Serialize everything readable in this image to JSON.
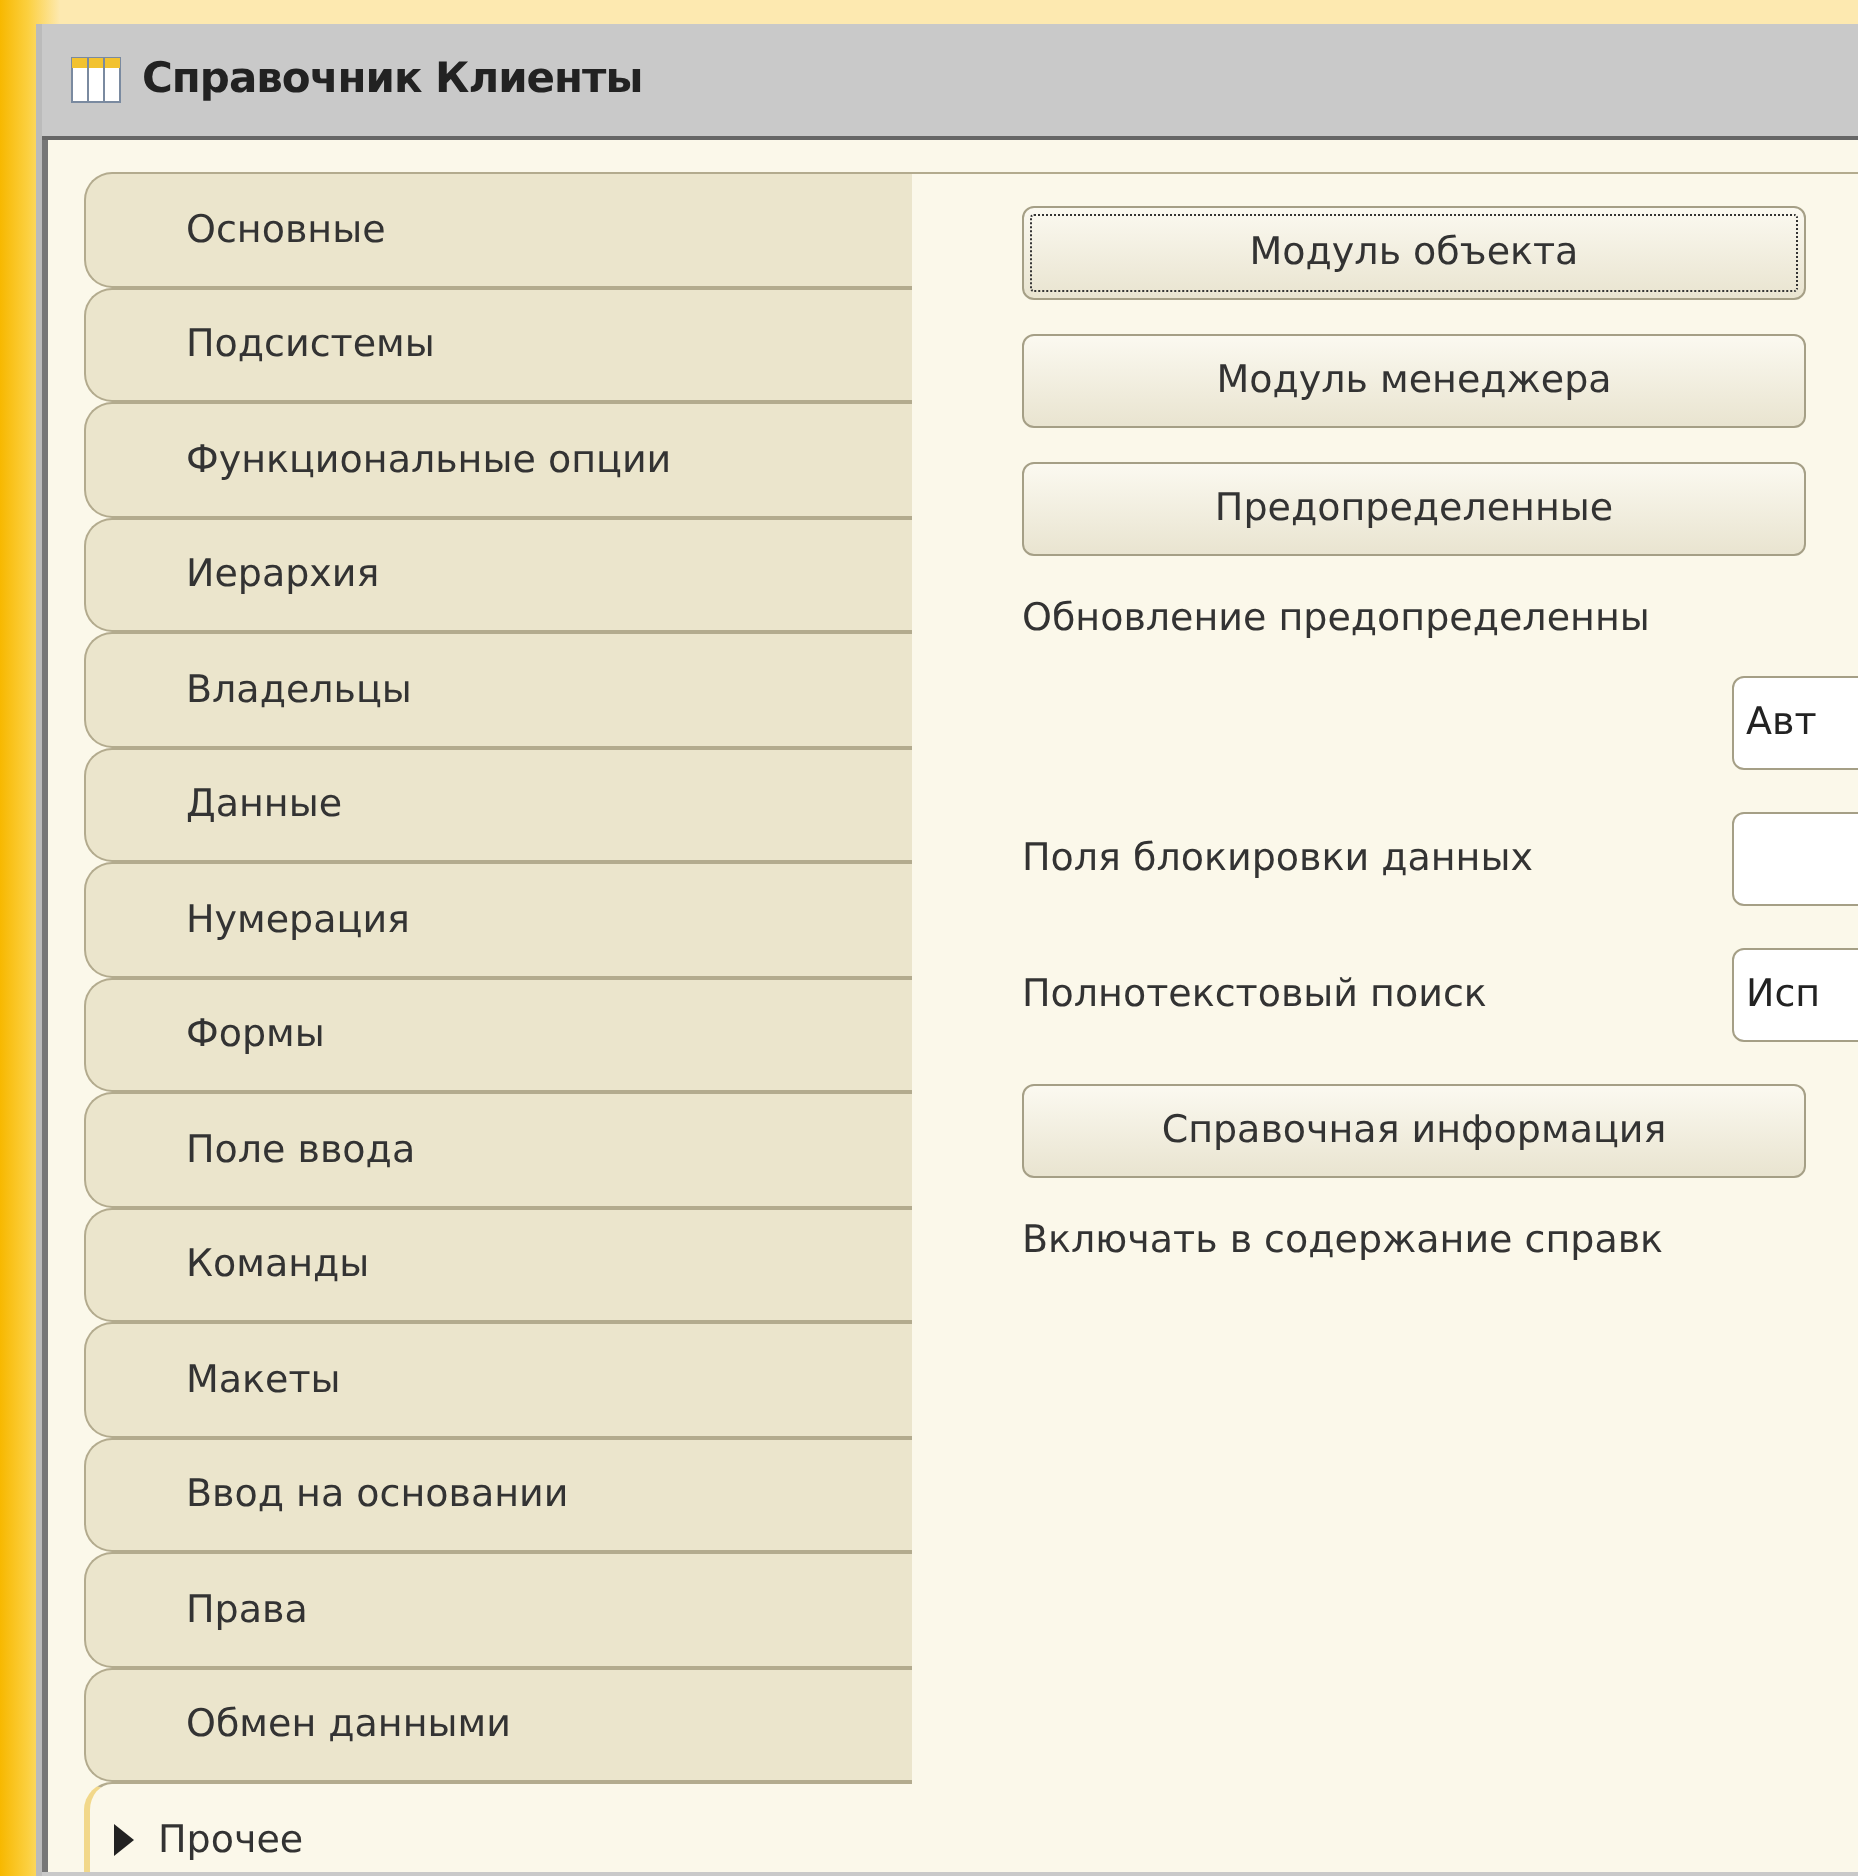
{
  "window": {
    "title": "Справочник Клиенты"
  },
  "tabs": [
    {
      "label": "Основные",
      "selected": false
    },
    {
      "label": "Подсистемы",
      "selected": false
    },
    {
      "label": "Функциональные опции",
      "selected": false
    },
    {
      "label": "Иерархия",
      "selected": false
    },
    {
      "label": "Владельцы",
      "selected": false
    },
    {
      "label": "Данные",
      "selected": false
    },
    {
      "label": "Нумерация",
      "selected": false
    },
    {
      "label": "Формы",
      "selected": false
    },
    {
      "label": "Поле ввода",
      "selected": false
    },
    {
      "label": "Команды",
      "selected": false
    },
    {
      "label": "Макеты",
      "selected": false
    },
    {
      "label": "Ввод на основании",
      "selected": false
    },
    {
      "label": "Права",
      "selected": false
    },
    {
      "label": "Обмен данными",
      "selected": false
    },
    {
      "label": "Прочее",
      "selected": true
    }
  ],
  "panel": [
    {
      "kind": "button",
      "label": "Модуль объекта",
      "focused": true
    },
    {
      "kind": "button",
      "label": "Модуль менеджера",
      "focused": false
    },
    {
      "kind": "button",
      "label": "Предопределенные",
      "focused": false
    },
    {
      "kind": "text",
      "text": "Обновление предопределенны"
    },
    {
      "kind": "field",
      "value": "Авт"
    },
    {
      "kind": "field",
      "label": "Поля блокировки данных"
    },
    {
      "kind": "field",
      "label": "Полнотекстовый поиск",
      "value": "Исп"
    },
    {
      "kind": "button",
      "label": "Справочная информация",
      "focused": false
    },
    {
      "kind": "text",
      "text": "Включать в содержание справк"
    }
  ]
}
